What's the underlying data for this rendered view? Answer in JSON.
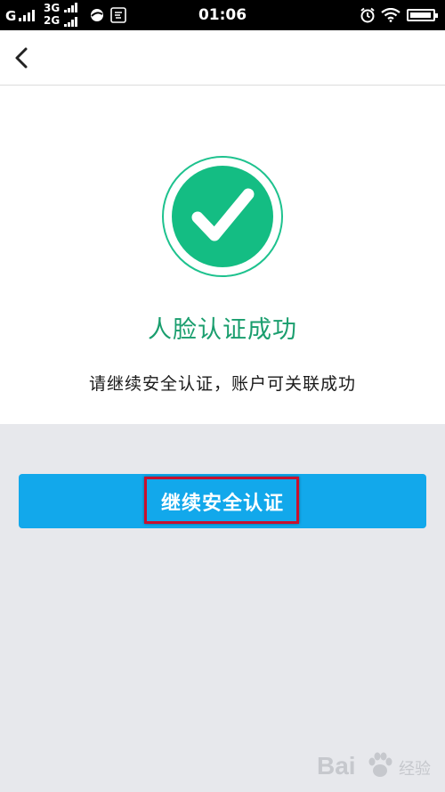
{
  "status_bar": {
    "carrier_g": "G",
    "network_top": "3G",
    "network_bottom": "2G",
    "time": "01:06",
    "icons": [
      "signal-icon",
      "browser-icon",
      "app-icon",
      "alarm-icon",
      "wifi-icon",
      "battery-icon"
    ]
  },
  "header": {
    "back_icon": "chevron-left-icon"
  },
  "content": {
    "icon": "check-circle-icon",
    "title": "人脸认证成功",
    "subtitle": "请继续安全认证，账户可关联成功"
  },
  "action": {
    "button_label": "继续安全认证"
  },
  "watermark": {
    "brand": "Bai",
    "brand_cn": "经验"
  },
  "colors": {
    "accent_green": "#14bd83",
    "title_green": "#1a9e6e",
    "button_blue": "#12a8eb",
    "highlight_red": "#c8102e",
    "background_gray": "#e7e8ec"
  }
}
